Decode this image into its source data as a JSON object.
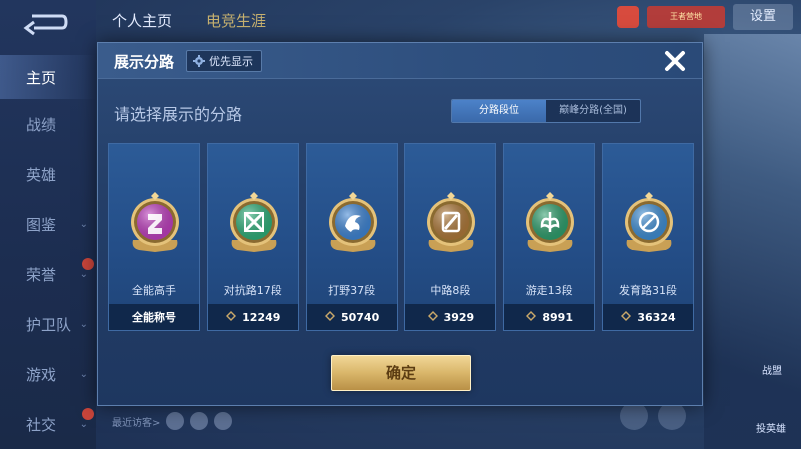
{
  "background": {
    "tabs": [
      "个人主页",
      "电竞生涯"
    ],
    "settings_label": "设置",
    "promo_text": "王者营地",
    "sidebar": [
      {
        "label": "主页",
        "active": true,
        "chevron": false,
        "new": false
      },
      {
        "label": "战绩",
        "active": false,
        "chevron": false,
        "new": false
      },
      {
        "label": "英雄",
        "active": false,
        "chevron": false,
        "new": false
      },
      {
        "label": "图鉴",
        "active": false,
        "chevron": true,
        "new": false
      },
      {
        "label": "荣誉",
        "active": false,
        "chevron": true,
        "new": true
      },
      {
        "label": "护卫队",
        "active": false,
        "chevron": true,
        "new": false
      },
      {
        "label": "游戏",
        "active": false,
        "chevron": true,
        "new": false
      },
      {
        "label": "社交",
        "active": false,
        "chevron": true,
        "new": true
      }
    ],
    "recent_visitors_label": "最近访客>",
    "right_labels": [
      "战盟",
      "投英雄"
    ]
  },
  "dialog": {
    "title": "展示分路",
    "priority_label": "优先显示",
    "subtitle": "请选择展示的分路",
    "toggle": [
      {
        "label": "分路段位",
        "active": true
      },
      {
        "label": "巅峰分路(全国)",
        "active": false
      }
    ],
    "cards": [
      {
        "lane": "全能高手",
        "footer": "全能称号",
        "emblem_color": "#c03fc0",
        "icon": "allround-emblem-icon",
        "has_value": false
      },
      {
        "lane": "对抗路17段",
        "footer": "12249",
        "emblem_color": "#2fb07a",
        "icon": "clash-lane-emblem-icon",
        "has_value": true
      },
      {
        "lane": "打野37段",
        "footer": "50740",
        "emblem_color": "#3f86d6",
        "icon": "jungle-emblem-icon",
        "has_value": true
      },
      {
        "lane": "中路8段",
        "footer": "3929",
        "emblem_color": "#b07a3a",
        "icon": "mid-lane-emblem-icon",
        "has_value": true
      },
      {
        "lane": "游走13段",
        "footer": "8991",
        "emblem_color": "#2fa06e",
        "icon": "roam-emblem-icon",
        "has_value": true
      },
      {
        "lane": "发育路31段",
        "footer": "36324",
        "emblem_color": "#3f8fd6",
        "icon": "farm-lane-emblem-icon",
        "has_value": true
      }
    ],
    "confirm_label": "确定"
  },
  "colors": {
    "accent_gold": "#d9b66a",
    "toggle_active": "#3a69aa",
    "card_bg": "#244e88",
    "card_footer_bg": "#10284b"
  }
}
